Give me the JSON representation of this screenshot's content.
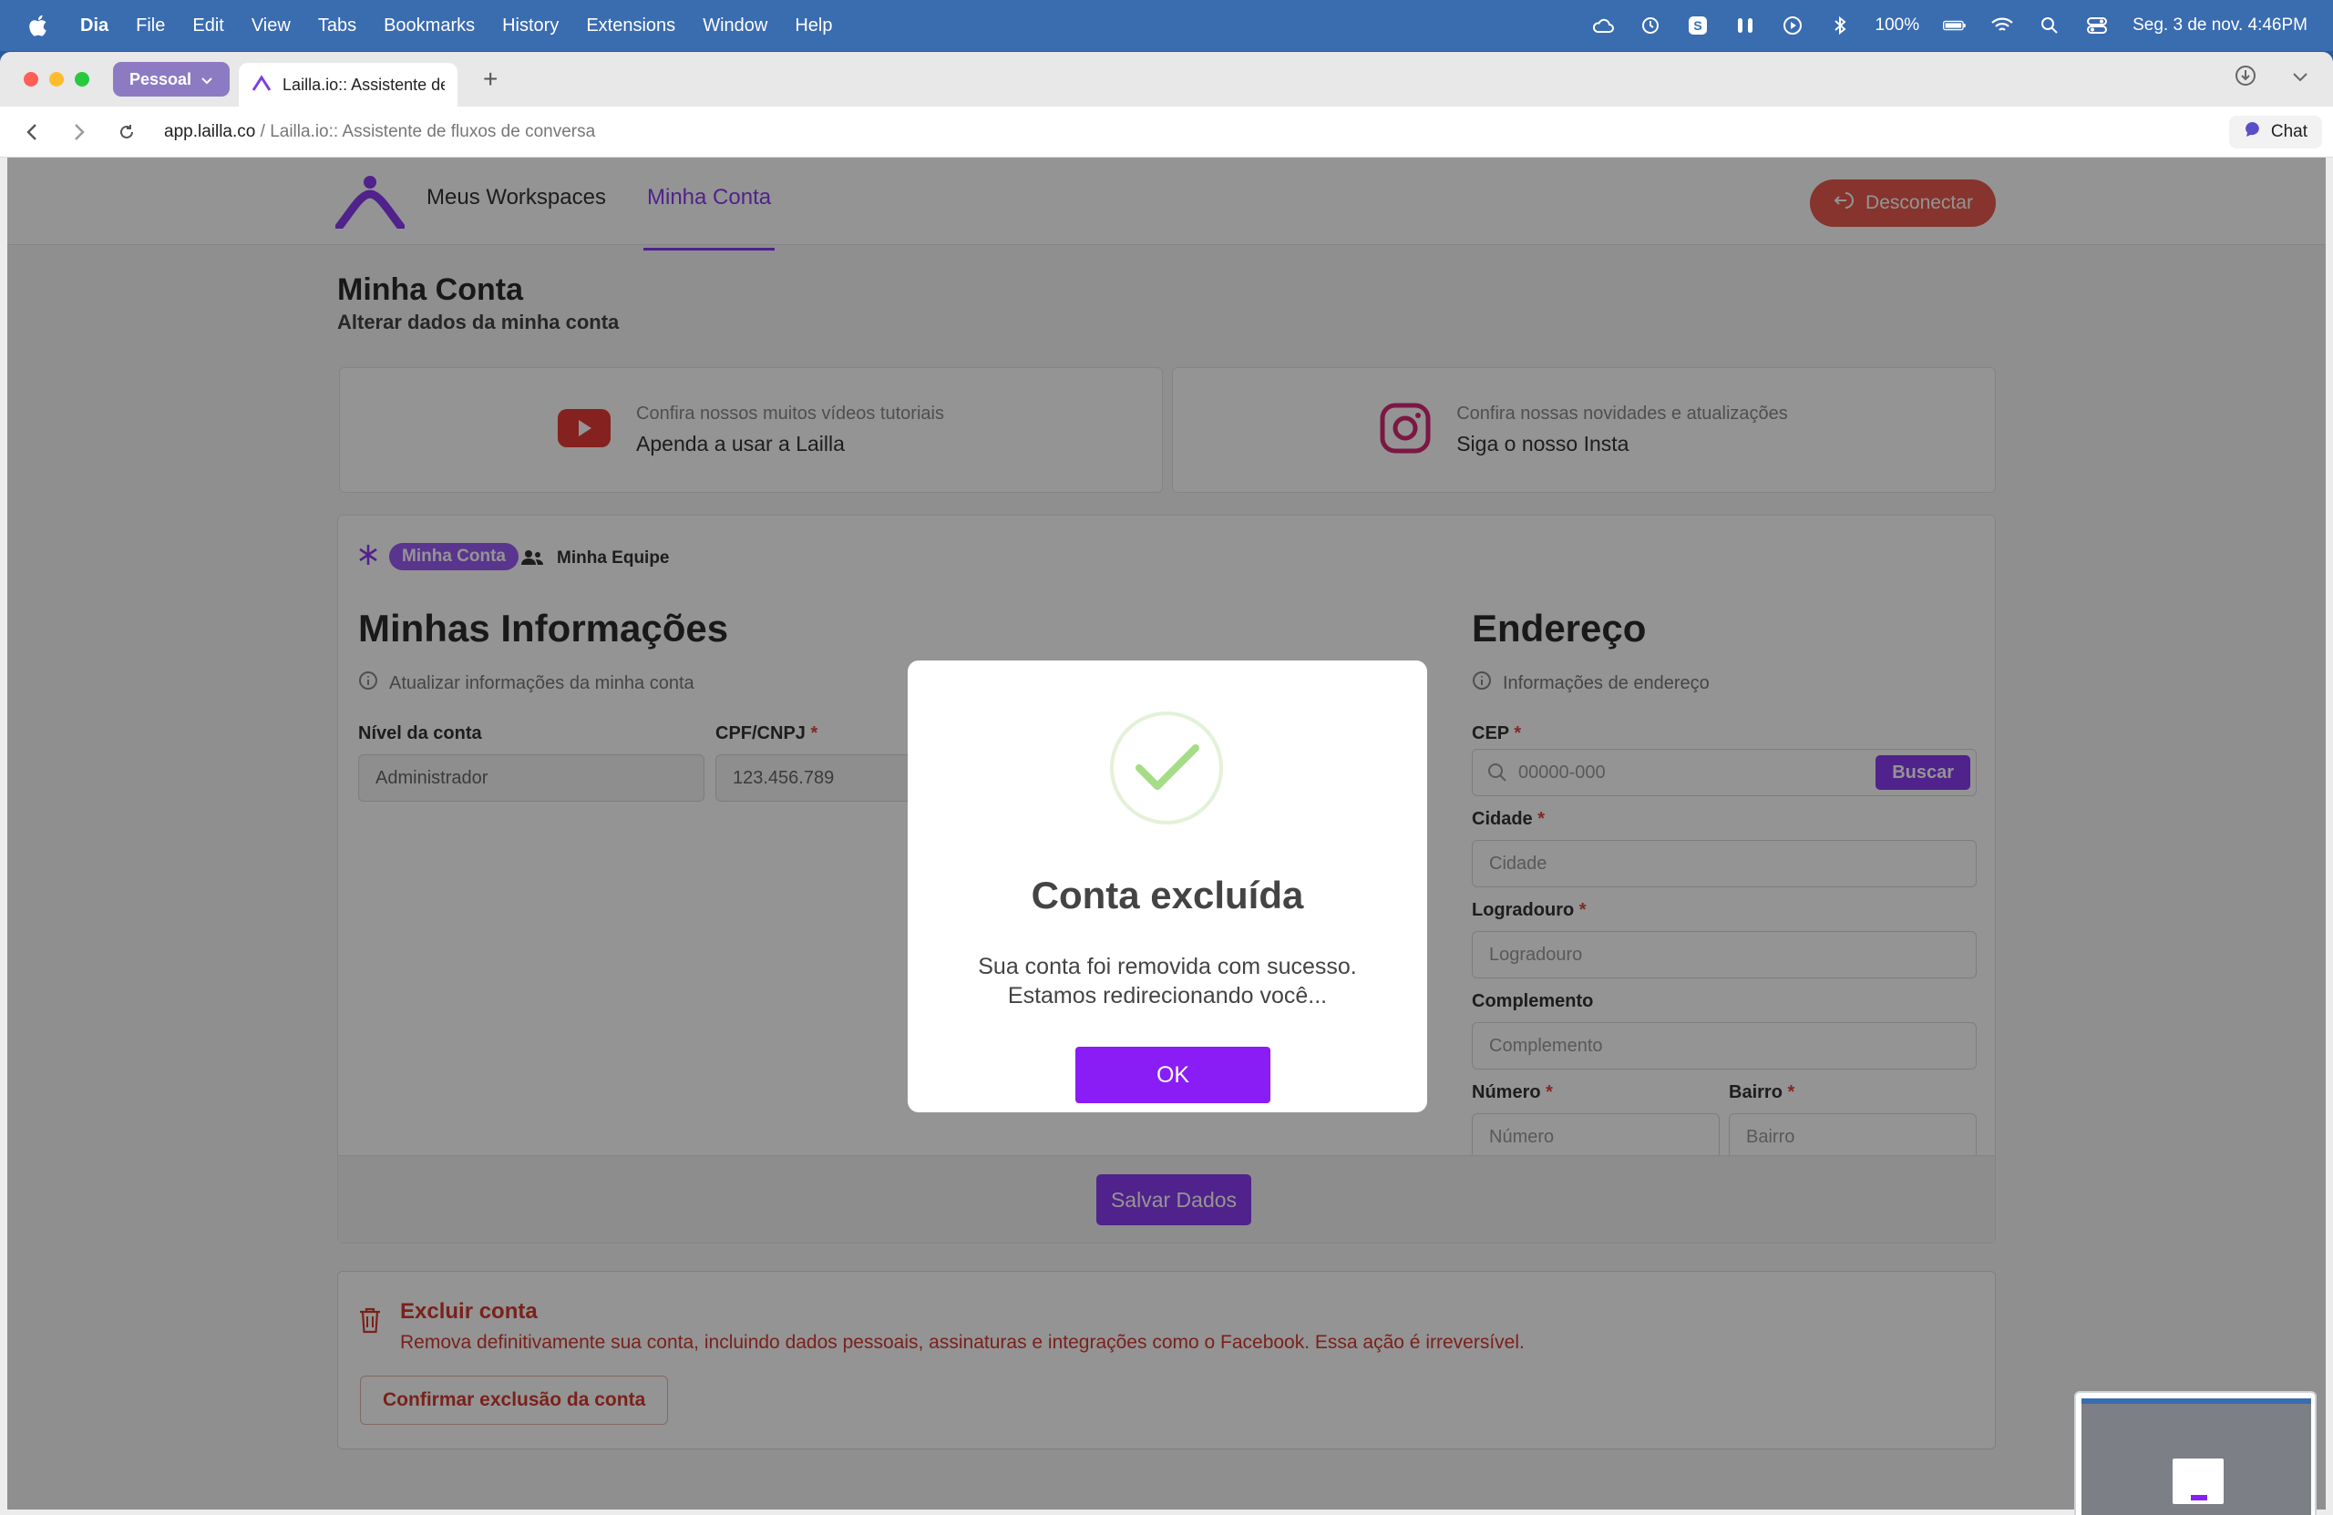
{
  "menubar": {
    "app": "Dia",
    "items": [
      "File",
      "Edit",
      "View",
      "Tabs",
      "Bookmarks",
      "History",
      "Extensions",
      "Window",
      "Help"
    ],
    "battery": "100%",
    "datetime": "Seg. 3 de nov.  4:46PM"
  },
  "browser": {
    "profile": "Pessoal",
    "tab_title": "Lailla.io:: Assistente de",
    "url_domain": "app.lailla.co",
    "url_sep": " / ",
    "url_title": "Lailla.io:: Assistente de fluxos de conversa",
    "chat_label": "Chat"
  },
  "nav": {
    "workspaces": "Meus Workspaces",
    "account": "Minha Conta",
    "disconnect": "Desconectar"
  },
  "page": {
    "title": "Minha Conta",
    "subtitle": "Alterar dados da minha conta"
  },
  "promos": [
    {
      "small": "Confira nossos muitos vídeos tutoriais",
      "big": "Apenda a usar a Lailla"
    },
    {
      "small": "Confira nossas novidades e atualizações",
      "big": "Siga o nosso Insta"
    }
  ],
  "tabs": {
    "account": "Minha Conta",
    "team": "Minha Equipe"
  },
  "info": {
    "heading": "Minhas Informações",
    "hint": "Atualizar informações da minha conta",
    "level_label": "Nível da conta",
    "level_value": "Administrador",
    "doc_label": "CPF/CNPJ",
    "doc_value": "123.456.789"
  },
  "address": {
    "heading": "Endereço",
    "hint": "Informações de endereço",
    "cep_label": "CEP",
    "cep_placeholder": "00000-000",
    "search_button": "Buscar",
    "city_label": "Cidade",
    "city_placeholder": "Cidade",
    "street_label": "Logradouro",
    "street_placeholder": "Logradouro",
    "complement_label": "Complemento",
    "complement_placeholder": "Complemento",
    "number_label": "Número",
    "number_placeholder": "Número",
    "district_label": "Bairro",
    "district_placeholder": "Bairro",
    "required_mark": "*"
  },
  "save_button": "Salvar Dados",
  "danger": {
    "title": "Excluir conta",
    "description": "Remova definitivamente sua conta, incluindo dados pessoais, assinaturas e integrações como o Facebook. Essa ação é irreversível.",
    "button": "Confirmar exclusão da conta"
  },
  "modal": {
    "title": "Conta excluída",
    "line1": "Sua conta foi removida com sucesso.",
    "line2": "Estamos redirecionando você...",
    "ok": "OK"
  },
  "colors": {
    "accent": "#8a3cf0",
    "danger": "#d33a30",
    "success": "#a5dc86"
  }
}
